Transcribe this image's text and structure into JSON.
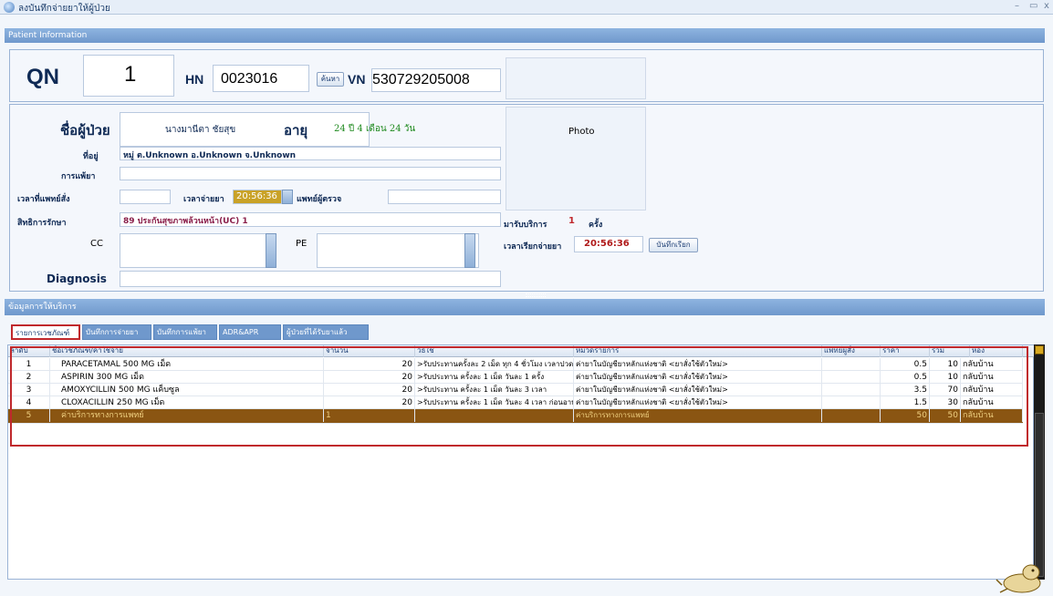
{
  "window": {
    "title": "ลงบันทึกจ่ายยาให้ผู้ป่วย",
    "min": "–",
    "max": "▭",
    "close": "x"
  },
  "patient_info": {
    "header": "Patient Information",
    "qn_label": "QN",
    "qn_value": "1",
    "hn_label": "HN",
    "hn_value": "0023016",
    "search_button": "ค้นหา",
    "vn_label": "VN",
    "vn_value": "530729205008",
    "name_label": "ชื่อผู้ป่วย",
    "name_value": "นางมานีตา ชัยสุข",
    "age_label": "อายุ",
    "age_value": "24 ปี 4 เดือน 24 วัน",
    "address_label": "ที่อยู่",
    "address_value": "หมู่ ต.Unknown อ.Unknown จ.Unknown",
    "allergy_label": "การแพ้ยา",
    "allergy_value": "",
    "order_time_label": "เวลาที่แพทย์สั่ง",
    "order_time_value": "",
    "dispense_time_label": "เวลาจ่ายยา",
    "dispense_time_value": "20:56:36",
    "doctor_label": "แพทย์ผู้ตรวจ",
    "doctor_value": "",
    "rights_label": "สิทธิการรักษา",
    "rights_value": "89 ประกันสุขภาพล้วนหน้า(UC) 1",
    "cc_label": "CC",
    "pe_label": "PE",
    "diagnosis_label": "Diagnosis",
    "photo_label": "Photo",
    "visits_label": "มารับบริการ",
    "visits_value": "1",
    "visits_unit": "ครั้ง",
    "call_time_label": "เวลาเรียกจ่ายยา",
    "call_time_value": "20:56:36",
    "call_button": "บันทึกเรียก"
  },
  "service": {
    "header": "ข้อมูลการให้บริการ",
    "tabs": [
      "รายการเวชภัณฑ์",
      "บันทึกการจ่ายยา",
      "บันทึกการแพ้ยา",
      "ADR&APR",
      "ผู้ป่วยที่ได้รับยาแล้ว"
    ],
    "columns": [
      "ลำดับ",
      "ชื่อเวชภัณฑ์/ค่าใช้จ่าย",
      "จำนวน",
      "วิธีใช้",
      "หมวดรายการ",
      "แพทย์ผู้สั่ง",
      "ราคา",
      "รวม",
      "ห้อง"
    ],
    "rows": [
      [
        "1",
        "PARACETAMAL 500 MG เม็ด",
        "20",
        ">รับประทานครั้งละ 2 เม็ด ทุก 4 ชั่วโมง เวลาปวด",
        "ค่ายาในบัญชียาหลักแห่งชาติ <ยาสั่งใช้ตัวใหม่>",
        "",
        "0.5",
        "10",
        "กลับบ้าน"
      ],
      [
        "2",
        "ASPIRIN 300 MG เม็ด",
        "20",
        ">รับประทาน ครั้งละ 1 เม็ด วันละ 1 ครั้ง",
        "ค่ายาในบัญชียาหลักแห่งชาติ <ยาสั่งใช้ตัวใหม่>",
        "",
        "0.5",
        "10",
        "กลับบ้าน"
      ],
      [
        "3",
        "AMOXYCILLIN 500 MG แค็บซูล",
        "20",
        ">รับประทาน ครั้งละ 1 เม็ด วันละ 3 เวลา",
        "ค่ายาในบัญชียาหลักแห่งชาติ <ยาสั่งใช้ตัวใหม่>",
        "",
        "3.5",
        "70",
        "กลับบ้าน"
      ],
      [
        "4",
        "CLOXACILLIN 250 MG เม็ด",
        "20",
        ">รับประทาน ครั้งละ 1 เม็ด วันละ 4 เวลา ก่อนอาหาร",
        "ค่ายาในบัญชียาหลักแห่งชาติ <ยาสั่งใช้ตัวใหม่>",
        "",
        "1.5",
        "30",
        "กลับบ้าน"
      ],
      [
        "5",
        "ค่าบริการทางการแพทย์",
        "1",
        "",
        "ค่าบริการทางการแพทย์",
        "",
        "50",
        "50",
        "กลับบ้าน"
      ]
    ]
  }
}
